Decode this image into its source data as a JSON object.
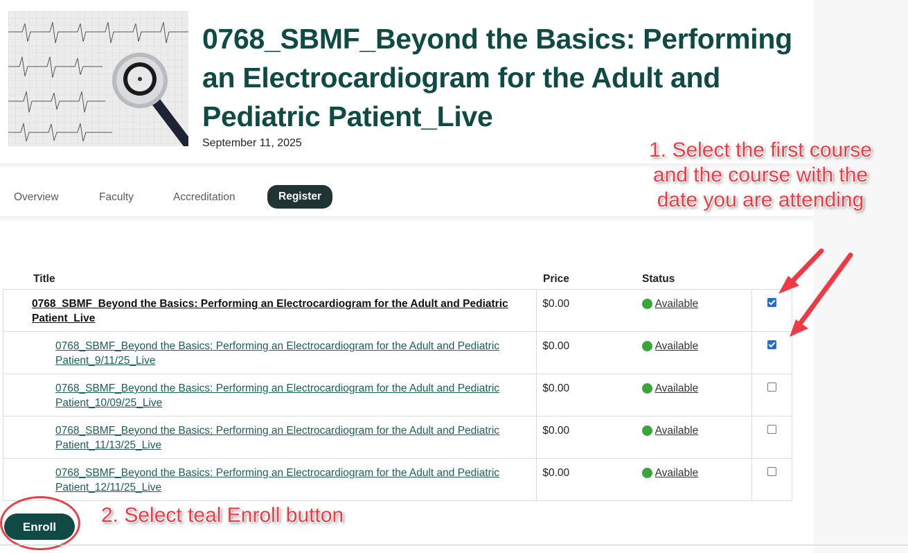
{
  "header": {
    "title": "0768_SBMF_Beyond the Basics: Performing an Electrocardiogram for the Adult and Pediatric Patient_Live",
    "date": "September 11, 2025"
  },
  "tabs": [
    {
      "label": "Overview",
      "active": false
    },
    {
      "label": "Faculty",
      "active": false
    },
    {
      "label": "Accreditation",
      "active": false
    },
    {
      "label": "Register",
      "active": true
    }
  ],
  "table": {
    "headers": {
      "title": "Title",
      "price": "Price",
      "status": "Status"
    },
    "rows": [
      {
        "title": "0768_SBMF_Beyond the Basics: Performing an Electrocardiogram for the Adult and Pediatric Patient_Live",
        "price": "$0.00",
        "status": "Available",
        "checked": true
      },
      {
        "title": "0768_SBMF_Beyond the Basics: Performing an Electrocardiogram for the Adult and Pediatric Patient_9/11/25_Live",
        "price": "$0.00",
        "status": "Available",
        "checked": true
      },
      {
        "title": "0768_SBMF_Beyond the Basics: Performing an Electrocardiogram for the Adult and Pediatric Patient_10/09/25_Live",
        "price": "$0.00",
        "status": "Available",
        "checked": false
      },
      {
        "title": "0768_SBMF_Beyond the Basics: Performing an Electrocardiogram for the Adult and Pediatric Patient_11/13/25_Live",
        "price": "$0.00",
        "status": "Available",
        "checked": false
      },
      {
        "title": "0768_SBMF_Beyond the Basics: Performing an Electrocardiogram for the Adult and Pediatric Patient_12/11/25_Live",
        "price": "$0.00",
        "status": "Available",
        "checked": false
      }
    ]
  },
  "enroll_label": "Enroll",
  "annotations": {
    "step1": "1. Select the first course and the course with the date you are attending",
    "step2": "2. Select teal Enroll button"
  },
  "colors": {
    "brand_teal": "#0f4a45",
    "tab_active": "#203433",
    "status_dot": "#3aa63a",
    "annotation": "#ef3a44",
    "checkbox_on": "#1e6fd1"
  }
}
